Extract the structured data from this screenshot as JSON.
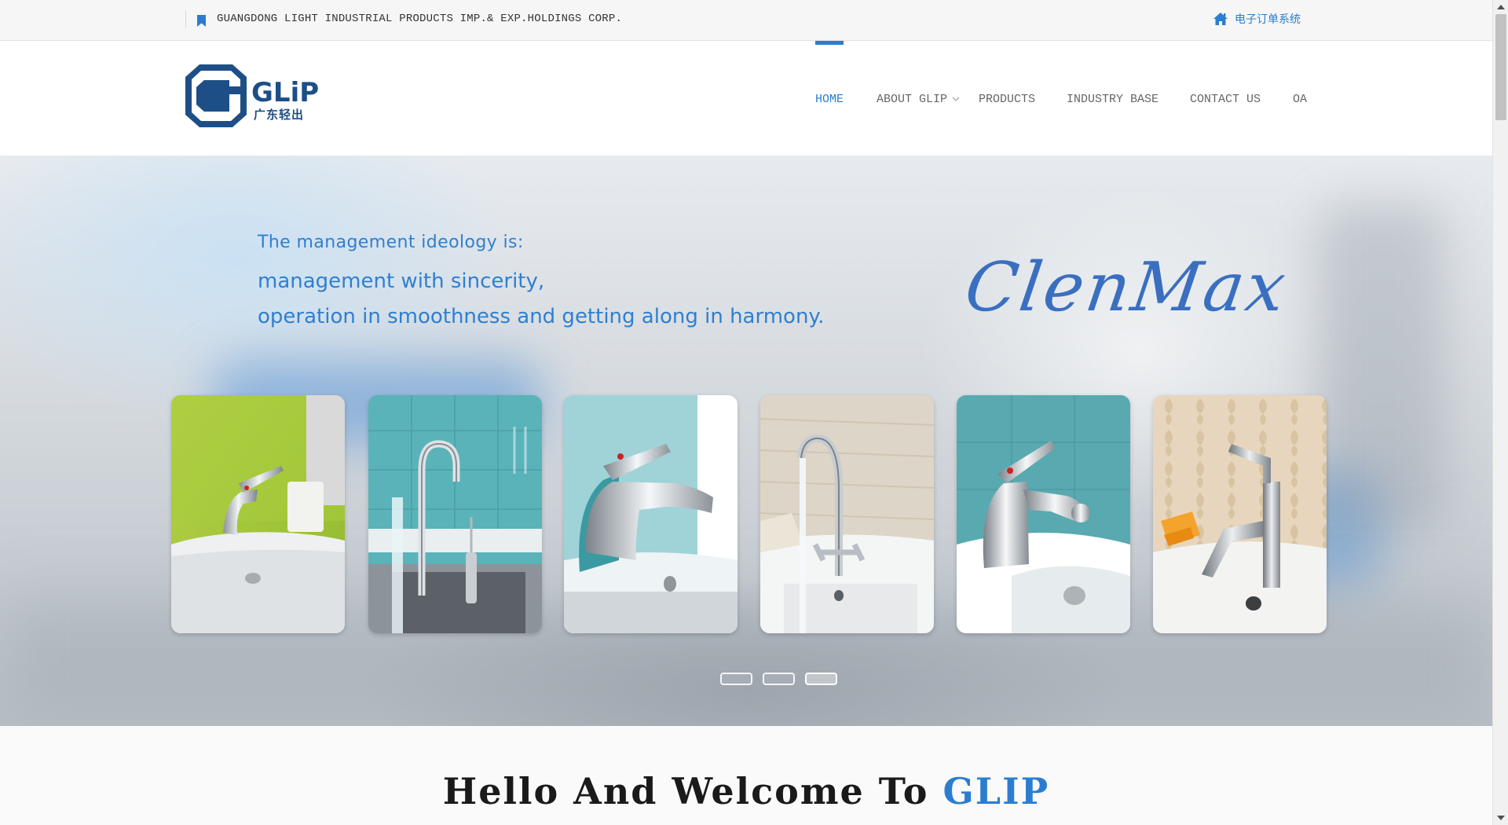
{
  "topbar": {
    "company_name": "GUANGDONG LIGHT INDUSTRIAL PRODUCTS IMP.& EXP.HOLDINGS CORP.",
    "bookmark_icon": "bookmark-icon",
    "order_system_label": "电子订单系统",
    "order_system_icon": "home-icon"
  },
  "header": {
    "logo": {
      "wordmark": "GLiP",
      "chinese_name": "广东轻出",
      "icon": "glip-logo"
    },
    "nav": [
      {
        "label": "HOME",
        "active": true
      },
      {
        "label": "ABOUT GLIP",
        "has_dropdown": true
      },
      {
        "label": "PRODUCTS"
      },
      {
        "label": "INDUSTRY BASE"
      },
      {
        "label": "CONTACT US"
      },
      {
        "label": "OA"
      }
    ]
  },
  "banner": {
    "ideology_intro": "The management ideology is:",
    "ideology_line1": "management with sincerity,",
    "ideology_line2": "operation in smoothness and getting along in harmony.",
    "brand_name": "ClenMax",
    "products": [
      "faucet-green-wall",
      "faucet-kitchen-sink",
      "faucet-teal-basin",
      "faucet-cross-handles",
      "faucet-bidet",
      "faucet-square-modern"
    ],
    "slide_count": 3,
    "active_slide": 3
  },
  "welcome": {
    "title_prefix": "Hello And Welcome To ",
    "title_accent": "GLIP"
  },
  "colors": {
    "accent": "#2a7dd1",
    "logo_navy": "#1d4f86",
    "topbar_bg": "#f6f6f6",
    "nav_text": "#666666"
  }
}
